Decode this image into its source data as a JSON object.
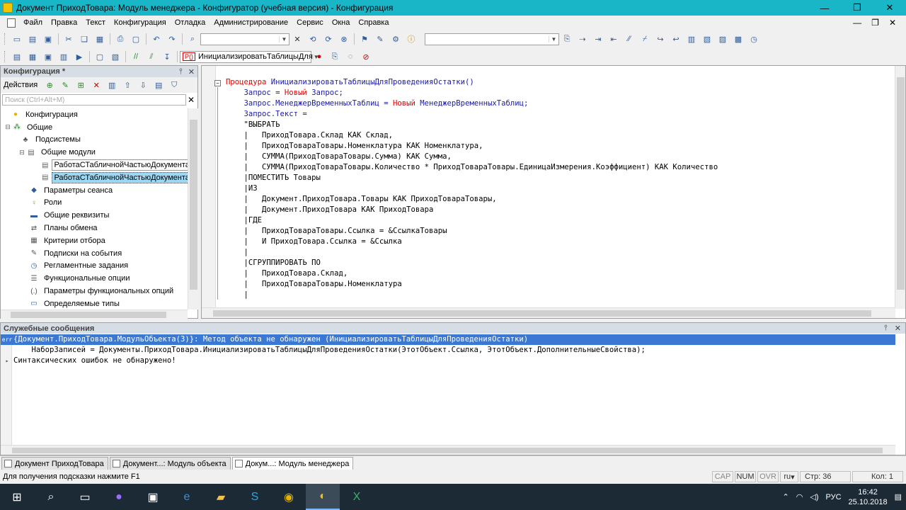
{
  "window": {
    "title": "Документ ПриходТовара: Модуль менеджера - Конфигуратор (учебная версия) - Конфигурация"
  },
  "menu": [
    "Файл",
    "Правка",
    "Текст",
    "Конфигурация",
    "Отладка",
    "Администрирование",
    "Сервис",
    "Окна",
    "Справка"
  ],
  "toolbar": {
    "procedure_combo": "ИнициализироватьТаблицыДля"
  },
  "config_panel": {
    "title": "Конфигурация *",
    "actions_label": "Действия",
    "search_placeholder": "Поиск (Ctrl+Alt+M)",
    "tree": [
      {
        "label": "Конфигурация",
        "icon": "config-icon"
      },
      {
        "label": "Общие",
        "icon": "common-icon"
      },
      {
        "label": "Подсистемы",
        "icon": "subsystems-icon"
      },
      {
        "label": "Общие модули",
        "icon": "modules-icon"
      },
      {
        "label": "РаботаСТабличнойЧастьюДокументаК",
        "icon": "module-icon"
      },
      {
        "label": "РаботаСТабличнойЧастьюДокументаС",
        "icon": "module-icon"
      },
      {
        "label": "Параметры сеанса",
        "icon": "session-params-icon"
      },
      {
        "label": "Роли",
        "icon": "roles-icon"
      },
      {
        "label": "Общие реквизиты",
        "icon": "attributes-icon"
      },
      {
        "label": "Планы обмена",
        "icon": "exchange-icon"
      },
      {
        "label": "Критерии отбора",
        "icon": "filter-criteria-icon"
      },
      {
        "label": "Подписки на события",
        "icon": "subscriptions-icon"
      },
      {
        "label": "Регламентные задания",
        "icon": "scheduled-jobs-icon"
      },
      {
        "label": "Функциональные опции",
        "icon": "functional-options-icon"
      },
      {
        "label": "Параметры функциональных опций",
        "icon": "fo-params-icon"
      },
      {
        "label": "Определяемые типы",
        "icon": "defined-types-icon"
      }
    ]
  },
  "code": [
    [
      {
        "t": "Процедура ",
        "c": "k"
      },
      {
        "t": "ИнициализироватьТаблицыДляПроведенияОстатки()",
        "c": "i"
      }
    ],
    [
      {
        "t": "    Запрос = ",
        "c": "i"
      },
      {
        "t": "Новый ",
        "c": "k"
      },
      {
        "t": "Запрос;",
        "c": "i"
      }
    ],
    [
      {
        "t": "    Запрос.МенеджерВременныхТаблиц = ",
        "c": "i"
      },
      {
        "t": "Новый ",
        "c": "k"
      },
      {
        "t": "МенеджерВременныхТаблиц;",
        "c": "i"
      }
    ],
    [
      {
        "t": "    Запрос.Текст = ",
        "c": "i"
      }
    ],
    [
      {
        "t": "    \"ВЫБРАТЬ",
        "c": ""
      }
    ],
    [
      {
        "t": "    |   ПриходТовара.Склад КАК Склад,",
        "c": ""
      }
    ],
    [
      {
        "t": "    |   ПриходТовараТовары.Номенклатура КАК Номенклатура,",
        "c": ""
      }
    ],
    [
      {
        "t": "    |   СУММА(ПриходТовараТовары.Сумма) КАК Сумма,",
        "c": ""
      }
    ],
    [
      {
        "t": "    |   СУММА(ПриходТовараТовары.Количество * ПриходТовараТовары.ЕдиницаИзмерения.Коэффициент) КАК Количество",
        "c": ""
      }
    ],
    [
      {
        "t": "    |ПОМЕСТИТЬ Товары",
        "c": ""
      }
    ],
    [
      {
        "t": "    |ИЗ",
        "c": ""
      }
    ],
    [
      {
        "t": "    |   Документ.ПриходТовара.Товары КАК ПриходТовараТовары,",
        "c": ""
      }
    ],
    [
      {
        "t": "    |   Документ.ПриходТовара КАК ПриходТовара",
        "c": ""
      }
    ],
    [
      {
        "t": "    |ГДЕ",
        "c": ""
      }
    ],
    [
      {
        "t": "    |   ПриходТовараТовары.Ссылка = &СсылкаТовары",
        "c": ""
      }
    ],
    [
      {
        "t": "    |   И ПриходТовара.Ссылка = &Ссылка",
        "c": ""
      }
    ],
    [
      {
        "t": "    |",
        "c": ""
      }
    ],
    [
      {
        "t": "    |СГРУППИРОВАТЬ ПО",
        "c": ""
      }
    ],
    [
      {
        "t": "    |   ПриходТовара.Склад,",
        "c": ""
      }
    ],
    [
      {
        "t": "    |   ПриходТовараТовары.Номенклатура",
        "c": ""
      }
    ],
    [
      {
        "t": "    |",
        "c": ""
      }
    ]
  ],
  "messages": {
    "title": "Служебные сообщения",
    "lines": [
      {
        "mark": "err",
        "text": "{Документ.ПриходТовара.МодульОбъекта(3)}: Метод объекта не обнаружен (ИнициализироватьТаблицыДляПроведенияОстатки)",
        "error": true
      },
      {
        "mark": "",
        "text": "    НаборЗаписей = Документы.ПриходТовара.ИнициализироватьТаблицыДляПроведенияОстатки(ЭтотОбъект.Ссылка, ЭтотОбъект.ДополнительныеСвойства);",
        "error": false
      },
      {
        "mark": "▸",
        "text": "Синтаксических ошибок не обнаружено!",
        "error": false
      }
    ]
  },
  "doc_tabs": [
    {
      "label": "Документ ПриходТовара",
      "active": false
    },
    {
      "label": "Документ...: Модуль объекта",
      "active": false
    },
    {
      "label": "Докум...: Модуль менеджера",
      "active": true
    }
  ],
  "status": {
    "hint": "Для получения подсказки нажмите F1",
    "cap": "CAP",
    "num": "NUM",
    "ovr": "OVR",
    "lang": "ru",
    "line": "Стр: 36",
    "col": "Кол: 1"
  },
  "taskbar": {
    "apps": [
      "windows-icon",
      "search-icon",
      "task-view-icon",
      "cortana-icon",
      "store-icon",
      "edge-icon",
      "explorer-icon",
      "skype-icon",
      "chrome-icon",
      "1c-icon",
      "excel-icon"
    ],
    "lang": "РУС",
    "time": "16:42",
    "date": "25.10.2018"
  }
}
